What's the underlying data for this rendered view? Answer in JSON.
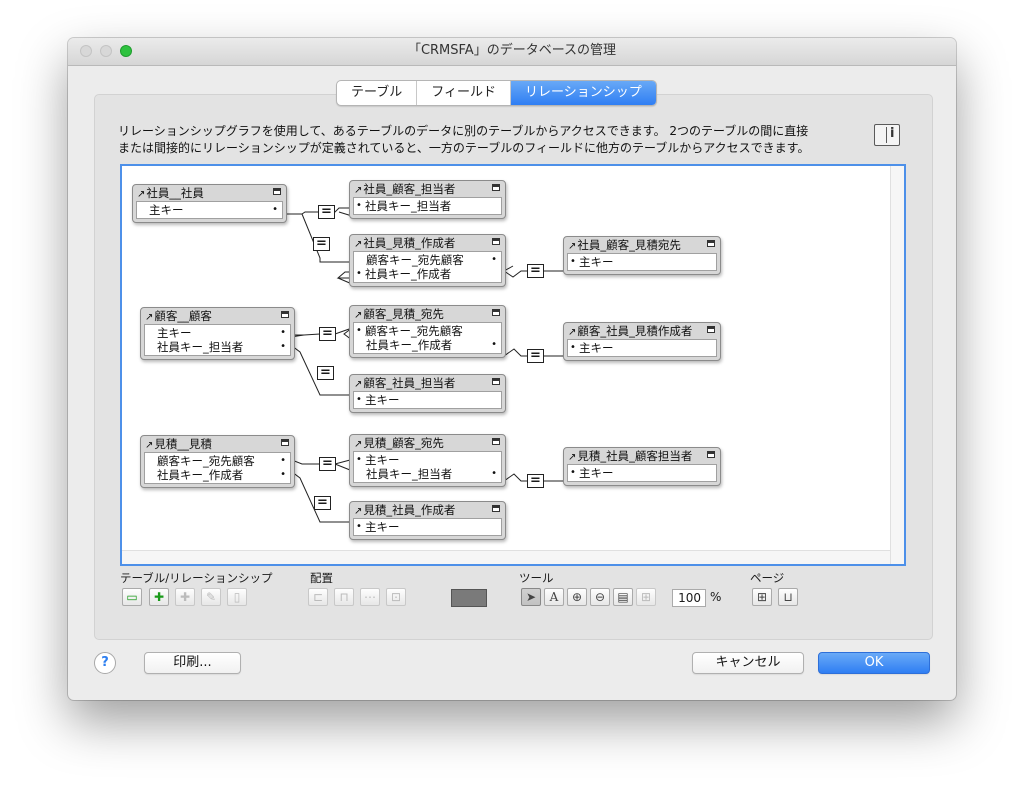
{
  "window": {
    "title": "「CRMSFA」のデータベースの管理"
  },
  "tabs": [
    {
      "label": "テーブル",
      "active": false
    },
    {
      "label": "フィールド",
      "active": false
    },
    {
      "label": "リレーションシップ",
      "active": true
    }
  ],
  "description": {
    "line1": "リレーションシップグラフを使用して、あるテーブルのデータに別のテーブルからアクセスできます。 2つのテーブルの間に直接",
    "line2": "または間接的にリレーションシップが定義されていると、一方のテーブルのフィールドに他方のテーブルからアクセスできます。"
  },
  "info_button_glyph": "i",
  "graph": {
    "relationship_symbol": "=",
    "table_occurrences": [
      {
        "name": "社員__社員",
        "fields": [
          {
            "name": "主キー"
          }
        ]
      },
      {
        "name": "社員_顧客_担当者",
        "fields": [
          {
            "name": "社員キー_担当者"
          }
        ]
      },
      {
        "name": "社員_見積_作成者",
        "fields": [
          {
            "name": "顧客キー_宛先顧客"
          },
          {
            "name": "社員キー_作成者"
          }
        ]
      },
      {
        "name": "社員_顧客_見積宛先",
        "fields": [
          {
            "name": "主キー"
          }
        ]
      },
      {
        "name": "顧客__顧客",
        "fields": [
          {
            "name": "主キー"
          },
          {
            "name": "社員キー_担当者"
          }
        ]
      },
      {
        "name": "顧客_見積_宛先",
        "fields": [
          {
            "name": "顧客キー_宛先顧客"
          },
          {
            "name": "社員キー_作成者"
          }
        ]
      },
      {
        "name": "顧客_社員_見積作成者",
        "fields": [
          {
            "name": "主キー"
          }
        ]
      },
      {
        "name": "顧客_社員_担当者",
        "fields": [
          {
            "name": "主キー"
          }
        ]
      },
      {
        "name": "見積__見積",
        "fields": [
          {
            "name": "顧客キー_宛先顧客"
          },
          {
            "name": "社員キー_作成者"
          }
        ]
      },
      {
        "name": "見積_顧客_宛先",
        "fields": [
          {
            "name": "主キー"
          },
          {
            "name": "社員キー_担当者"
          }
        ]
      },
      {
        "name": "見積_社員_顧客担当者",
        "fields": [
          {
            "name": "主キー"
          }
        ]
      },
      {
        "name": "見積_社員_作成者",
        "fields": [
          {
            "name": "主キー"
          }
        ]
      }
    ]
  },
  "toolbar": {
    "section_tables": "テーブル/リレーションシップ",
    "section_arrange": "配置",
    "section_tools": "ツール",
    "section_page": "ページ",
    "zoom": "100",
    "zoom_unit": "%",
    "text_tool_glyph": "A"
  },
  "footer": {
    "help_glyph": "?",
    "print_label": "印刷...",
    "cancel_label": "キャンセル",
    "ok_label": "OK"
  },
  "colors": {
    "accent": "#2f7ef3",
    "canvas_border": "#4d90e9",
    "traffic_zoom": "#2ec23f"
  }
}
